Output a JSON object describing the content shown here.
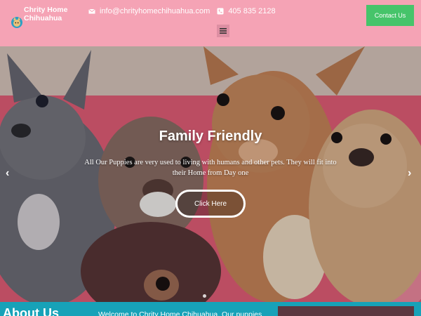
{
  "header": {
    "brand": "Chrity Home Chihuahua",
    "email": "info@chrityhomechihuahua.com",
    "phone": "405 835 2128",
    "contact_button": "Contact Us"
  },
  "icons": {
    "logo": "dog-logo-icon",
    "email": "envelope-icon",
    "phone": "phone-icon",
    "menu": "hamburger-menu-icon",
    "prev": "chevron-left-icon",
    "next": "chevron-right-icon"
  },
  "hero": {
    "title": "Family Friendly",
    "subtitle": "All Our Puppies are very used to living with humans and other pets. They will fit into their Home from Day one",
    "button": "Click Here",
    "prev_arrow": "‹",
    "next_arrow": "›"
  },
  "about": {
    "title": "About Us",
    "text": "Welcome to Chrity Home Chihuahua. Our puppies"
  },
  "colors": {
    "header_bg": "#f5a3b5",
    "contact_button": "#46c46a",
    "about_bg": "#17a2b8"
  }
}
